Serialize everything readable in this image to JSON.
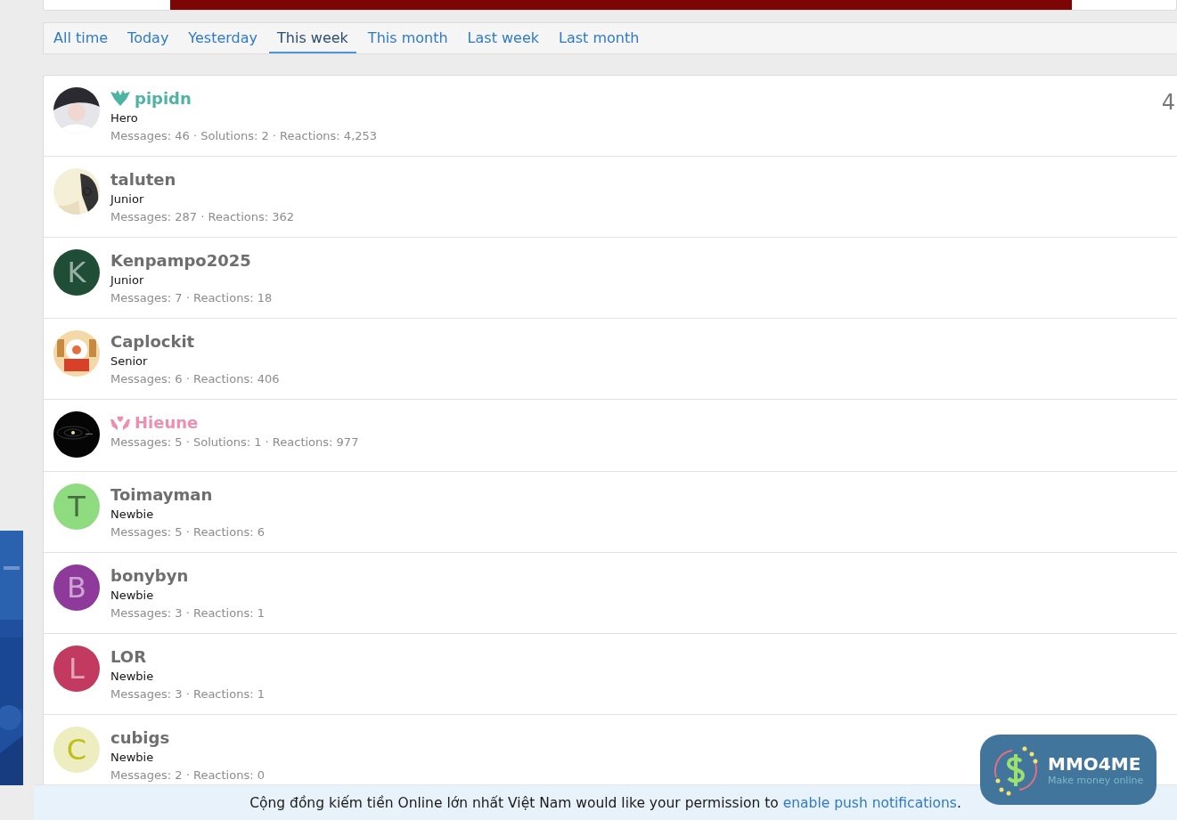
{
  "tabs": [
    {
      "label": "All time",
      "selected": false
    },
    {
      "label": "Today",
      "selected": false
    },
    {
      "label": "Yesterday",
      "selected": false
    },
    {
      "label": "This week",
      "selected": true
    },
    {
      "label": "This month",
      "selected": false
    },
    {
      "label": "Last week",
      "selected": false
    },
    {
      "label": "Last month",
      "selected": false
    }
  ],
  "members": [
    {
      "kind": "wings",
      "name": "pipidn",
      "color": "#4fb3a4",
      "title": "Hero",
      "stats": "Messages: 46 · Solutions: 2 · Reactions: 4,253",
      "column_3": "4"
    },
    {
      "kind": "plain",
      "name": "taluten",
      "color": "#6e6e6e",
      "title": "Junior",
      "stats": "Messages: 287 · Reactions: 362"
    },
    {
      "kind": "plain",
      "name": "Kenpampo2025",
      "color": "#6e6e6e",
      "avatar": {
        "kind": "letter",
        "letter": "K",
        "color": "#1f4d36"
      },
      "title": "Junior",
      "stats": "Messages: 7 · Reactions: 18"
    },
    {
      "kind": "plain",
      "name": "Caplockit",
      "color": "#6e6e6e",
      "title": "Senior",
      "stats": "Messages: 6 · Reactions: 406"
    },
    {
      "kind": "hands",
      "name": "Hieune",
      "color": "#ee8fb0",
      "stats": "Messages: 5 · Solutions: 1 · Reactions: 977"
    },
    {
      "kind": "plain",
      "name": "Toimayman",
      "color": "#6e6e6e",
      "avatar": {
        "kind": "letter",
        "letter": "T",
        "color": "#8fdc80"
      },
      "title": "Newbie",
      "stats": "Messages: 5 · Reactions: 6"
    },
    {
      "kind": "plain",
      "name": "bonybyn",
      "color": "#6e6e6e",
      "avatar": {
        "kind": "letter",
        "letter": "B",
        "color": "#8e3a9a"
      },
      "title": "Newbie",
      "stats": "Messages: 3 · Reactions: 1"
    },
    {
      "kind": "plain",
      "name": "LOR",
      "color": "#6e6e6e",
      "avatar": {
        "kind": "letter",
        "letter": "L",
        "color": "#c23a60"
      },
      "title": "Newbie",
      "stats": "Messages: 3 · Reactions: 1"
    },
    {
      "kind": "plain",
      "name": "cubigs",
      "color": "#6e6e6e",
      "avatar": {
        "kind": "letter",
        "letter": "C",
        "color": "#eeedc0"
      },
      "title": "Newbie",
      "stats": "Messages: 2 · Reactions: 0"
    }
  ],
  "logo": {
    "name": "MMO4ME",
    "tagline": "Make money online"
  },
  "push_notice": {
    "text": "Cộng đồng kiếm tiền Online lớn nhất Việt Nam would like your permission to",
    "link": "enable push notifications",
    "end": "."
  }
}
